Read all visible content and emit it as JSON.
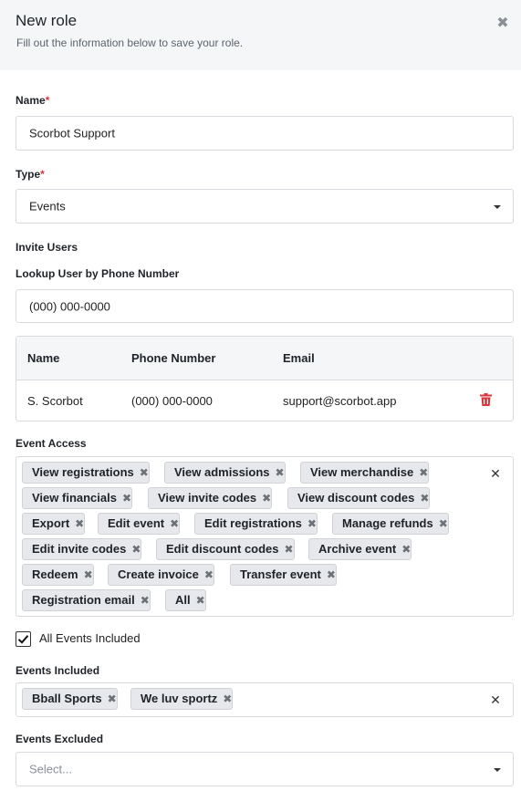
{
  "header": {
    "title": "New role",
    "subtitle": "Fill out the information below to save your role.",
    "close_glyph": "✖"
  },
  "form": {
    "name_label": "Name",
    "name_value": "Scorbot Support",
    "type_label": "Type",
    "type_value": "Events",
    "required_mark": "*",
    "invite_users_label": "Invite Users",
    "lookup_label": "Lookup User by Phone Number",
    "lookup_value": "(000) 000-0000"
  },
  "users_table": {
    "columns": [
      "Name",
      "Phone Number",
      "Email"
    ],
    "rows": [
      {
        "name": "S. Scorbot",
        "phone": "(000) 000-0000",
        "email": "support@scorbot.app"
      }
    ]
  },
  "event_access": {
    "label": "Event Access",
    "tags": [
      "View registrations",
      "View admissions",
      "View merchandise",
      "View financials",
      "View invite codes",
      "View discount codes",
      "Export",
      "Edit event",
      "Edit registrations",
      "Manage refunds",
      "Edit invite codes",
      "Edit discount codes",
      "Archive event",
      "Redeem",
      "Create invoice",
      "Transfer event",
      "Registration email",
      "All"
    ]
  },
  "all_events": {
    "label": "All Events Included",
    "checked": true
  },
  "events_included": {
    "label": "Events Included",
    "tags": [
      "Bball Sports",
      "We luv sportz"
    ]
  },
  "events_excluded": {
    "label": "Events Excluded",
    "placeholder": "Select..."
  },
  "colors": {
    "accent_required": "#d9363e",
    "trash": "#d9363e",
    "header_bg": "#f4f6f8",
    "tag_bg": "#e6e8eb"
  },
  "icons": {
    "close": "close-icon",
    "caret": "chevron-down-icon",
    "trash": "trash-icon",
    "tag_remove": "remove-tag-icon",
    "clear": "clear-icon",
    "check": "check-icon"
  }
}
